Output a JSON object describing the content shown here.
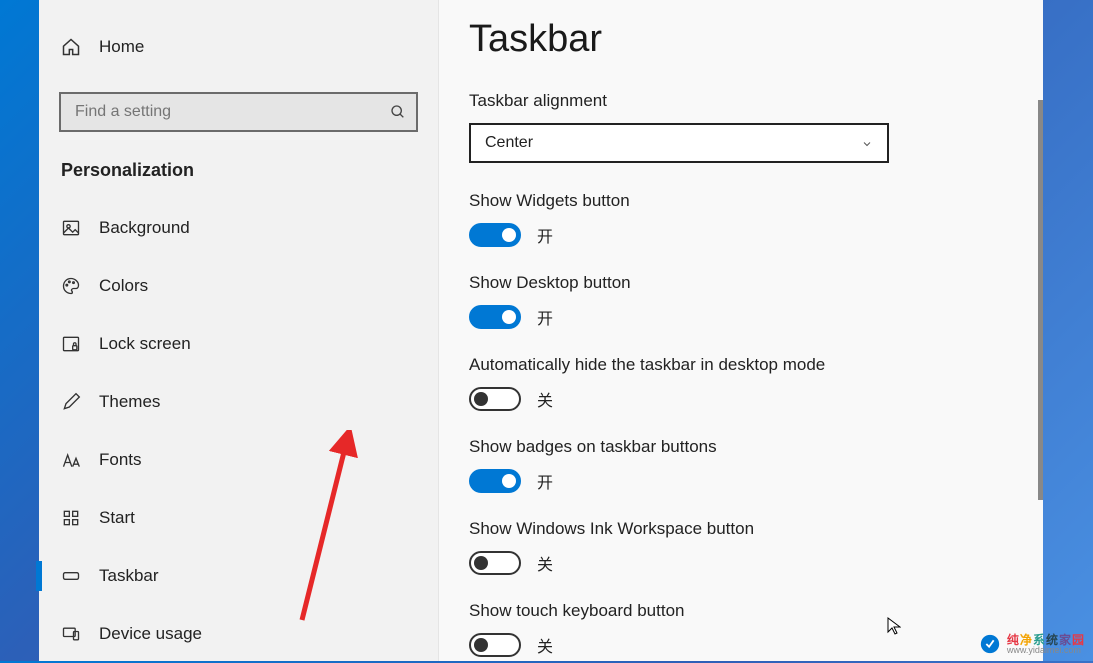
{
  "sidebar": {
    "home_label": "Home",
    "search_placeholder": "Find a setting",
    "category": "Personalization",
    "items": [
      {
        "label": "Background",
        "icon": "image"
      },
      {
        "label": "Colors",
        "icon": "palette"
      },
      {
        "label": "Lock screen",
        "icon": "lock"
      },
      {
        "label": "Themes",
        "icon": "brush"
      },
      {
        "label": "Fonts",
        "icon": "font"
      },
      {
        "label": "Start",
        "icon": "grid"
      },
      {
        "label": "Taskbar",
        "icon": "taskbar",
        "active": true
      },
      {
        "label": "Device usage",
        "icon": "device"
      }
    ]
  },
  "page": {
    "title": "Taskbar",
    "alignment_label": "Taskbar alignment",
    "alignment_value": "Center",
    "toggles": [
      {
        "label": "Show Widgets button",
        "on": true,
        "state": "开"
      },
      {
        "label": "Show Desktop button",
        "on": true,
        "state": "开"
      },
      {
        "label": "Automatically hide the taskbar in desktop mode",
        "on": false,
        "state": "关"
      },
      {
        "label": "Show badges on taskbar buttons",
        "on": true,
        "state": "开"
      },
      {
        "label": "Show Windows Ink Workspace button",
        "on": false,
        "state": "关"
      },
      {
        "label": "Show touch keyboard button",
        "on": false,
        "state": "关"
      }
    ]
  },
  "watermark": {
    "main": "纯净系统家园",
    "sub": "www.yidaimei.com"
  }
}
